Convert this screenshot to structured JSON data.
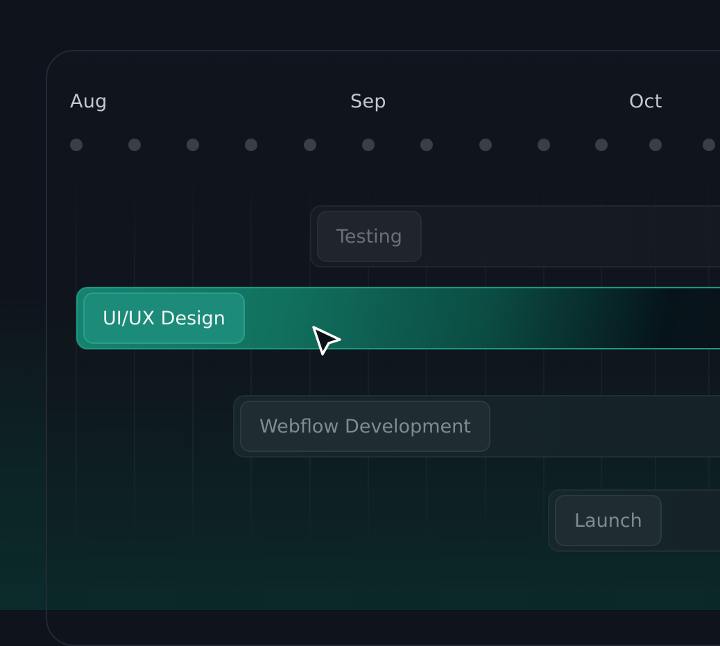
{
  "timeline": {
    "months": [
      {
        "label": "Aug"
      },
      {
        "label": "Sep"
      },
      {
        "label": "Oct"
      }
    ],
    "tasks": [
      {
        "label": "Testing"
      },
      {
        "label": "UI/UX Design"
      },
      {
        "label": "Webflow Development"
      },
      {
        "label": "Launch"
      }
    ]
  },
  "icons": {
    "cursor": "arrow-cursor-icon",
    "tick": "timeline-dot-icon"
  },
  "colors": {
    "accent": "#1c8b79",
    "background": "#0f131b",
    "chip": "#23282f"
  }
}
